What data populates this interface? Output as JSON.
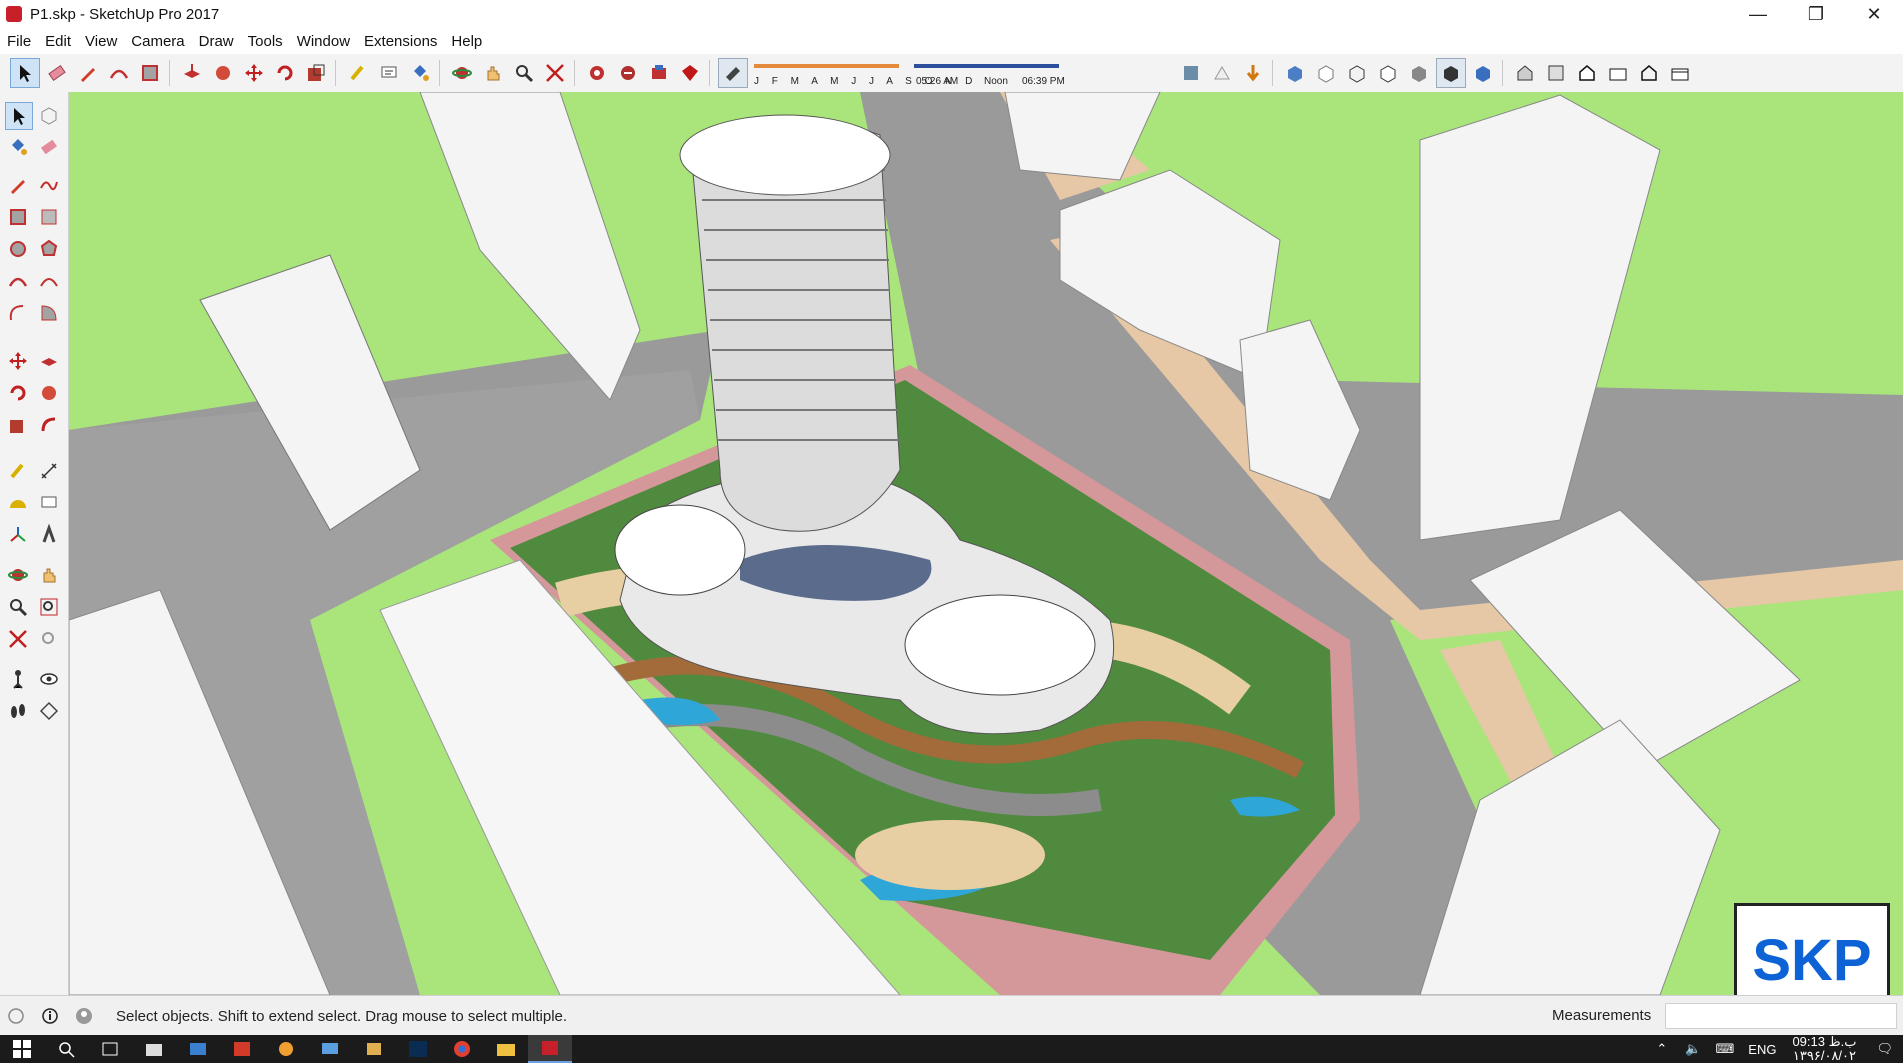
{
  "window": {
    "title": "P1.skp - SketchUp Pro 2017",
    "minimize": "—",
    "restore": "❐",
    "close": "✕"
  },
  "menu": [
    "File",
    "Edit",
    "View",
    "Camera",
    "Draw",
    "Tools",
    "Window",
    "Extensions",
    "Help"
  ],
  "shadow": {
    "months": "J F M A M J J A S O N D",
    "time_start": "05:26 AM",
    "time_mid": "Noon",
    "time_end": "06:39 PM"
  },
  "status": {
    "hint": "Select objects. Shift to extend select. Drag mouse to select multiple.",
    "measurements_label": "Measurements",
    "measurements_value": ""
  },
  "badge": {
    "text": "SKP"
  },
  "tray": {
    "lang": "ENG",
    "time": "09:13 ب.ظ",
    "date": "۱۳۹۶/۰۸/۰۲"
  },
  "colors": {
    "ground": "#a9e57a",
    "road": "#9a9a9a",
    "sidewalk": "#e6c7a6",
    "building": "#f4f4f4",
    "brand": "#c8202a",
    "skp_blue": "#0d63d6"
  }
}
